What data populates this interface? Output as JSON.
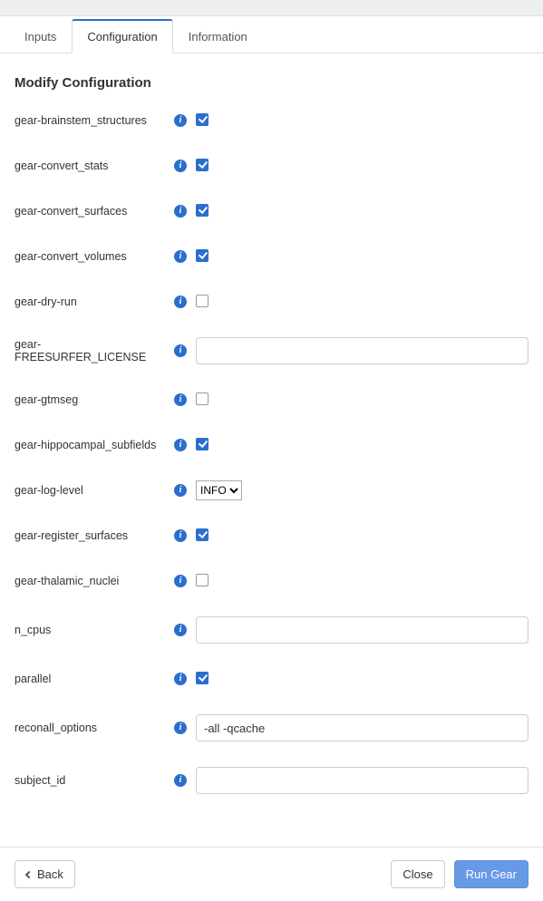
{
  "tabs": {
    "inputs": "Inputs",
    "configuration": "Configuration",
    "information": "Information",
    "active": "configuration"
  },
  "section_title": "Modify Configuration",
  "fields": {
    "brainstem": {
      "label": "gear-brainstem_structures",
      "type": "checkbox",
      "value": true
    },
    "convert_stats": {
      "label": "gear-convert_stats",
      "type": "checkbox",
      "value": true
    },
    "convert_surfaces": {
      "label": "gear-convert_surfaces",
      "type": "checkbox",
      "value": true
    },
    "convert_volumes": {
      "label": "gear-convert_volumes",
      "type": "checkbox",
      "value": true
    },
    "dry_run": {
      "label": "gear-dry-run",
      "type": "checkbox",
      "value": false
    },
    "freesurfer_lic": {
      "label": "gear-FREESURFER_LICENSE",
      "type": "text",
      "value": ""
    },
    "gtmseg": {
      "label": "gear-gtmseg",
      "type": "checkbox",
      "value": false
    },
    "hippocampal": {
      "label": "gear-hippocampal_subfields",
      "type": "checkbox",
      "value": true
    },
    "log_level": {
      "label": "gear-log-level",
      "type": "select",
      "value": "INFO",
      "options": [
        "INFO"
      ]
    },
    "register_surf": {
      "label": "gear-register_surfaces",
      "type": "checkbox",
      "value": true
    },
    "thalamic": {
      "label": "gear-thalamic_nuclei",
      "type": "checkbox",
      "value": false
    },
    "n_cpus": {
      "label": "n_cpus",
      "type": "text",
      "value": ""
    },
    "parallel": {
      "label": "parallel",
      "type": "checkbox",
      "value": true
    },
    "reconall": {
      "label": "reconall_options",
      "type": "text",
      "value": "-all -qcache"
    },
    "subject_id": {
      "label": "subject_id",
      "type": "text",
      "value": ""
    }
  },
  "buttons": {
    "back": "Back",
    "close": "Close",
    "run": "Run Gear"
  }
}
